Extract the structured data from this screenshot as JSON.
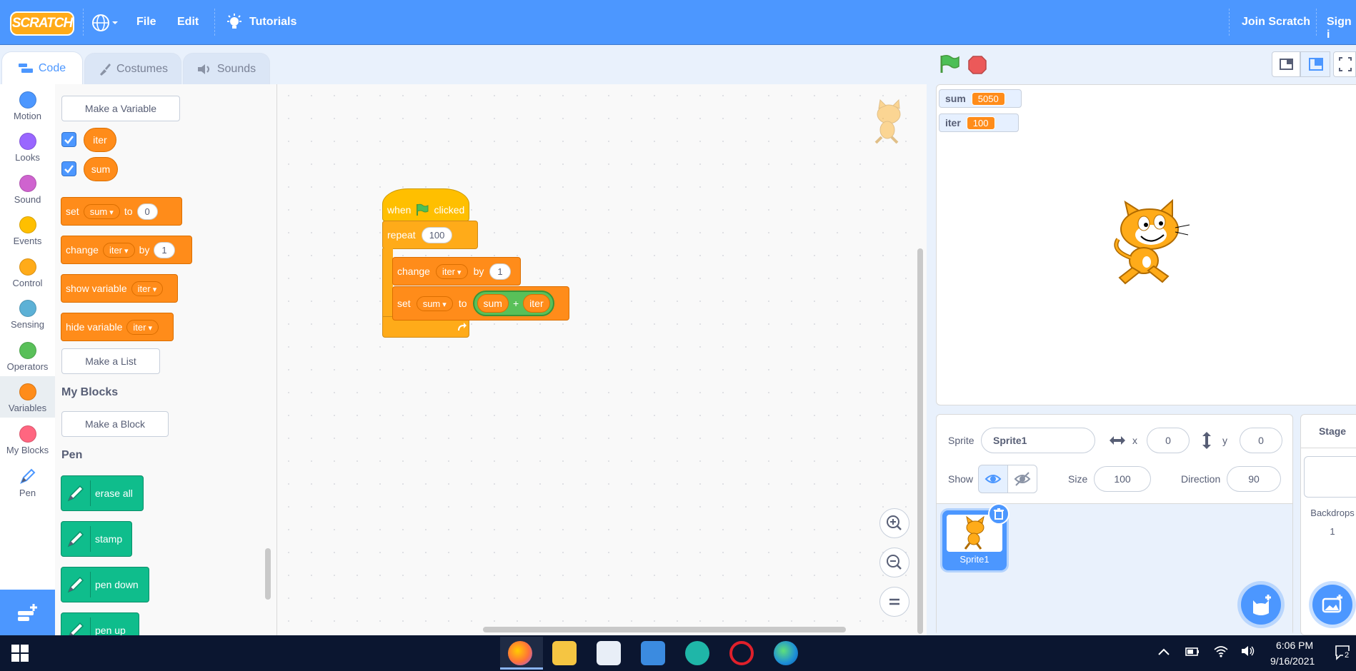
{
  "menu": {
    "logo_text": "SCRATCH",
    "file": "File",
    "edit": "Edit",
    "tutorials": "Tutorials",
    "join": "Join Scratch",
    "signin": "Sign i"
  },
  "tabs": {
    "code": "Code",
    "costumes": "Costumes",
    "sounds": "Sounds"
  },
  "categories": {
    "motion": "Motion",
    "looks": "Looks",
    "sound": "Sound",
    "events": "Events",
    "control": "Control",
    "sensing": "Sensing",
    "operators": "Operators",
    "variables": "Variables",
    "myblocks": "My Blocks",
    "pen": "Pen"
  },
  "palette": {
    "make_variable": "Make a Variable",
    "var_iter": "iter",
    "var_sum": "sum",
    "set_label": "set",
    "set_var": "sum",
    "set_to": "to",
    "set_value": "0",
    "change_label": "change",
    "change_var": "iter",
    "change_by": "by",
    "change_value": "1",
    "show_label": "show variable",
    "show_var": "iter",
    "hide_label": "hide variable",
    "hide_var": "iter",
    "make_list": "Make a List",
    "myblocks_heading": "My Blocks",
    "make_block": "Make a Block",
    "pen_heading": "Pen",
    "erase_all": "erase all",
    "stamp": "stamp",
    "pen_down": "pen down",
    "pen_up": "pen up"
  },
  "script": {
    "when": "when",
    "clicked": "clicked",
    "repeat": "repeat",
    "repeat_count": "100",
    "change": "change",
    "change_var": "iter",
    "change_by": "by",
    "change_value": "1",
    "set": "set",
    "set_var": "sum",
    "set_to": "to",
    "op_left": "sum",
    "op_symbol": "+",
    "op_right": "iter"
  },
  "stage": {
    "monitors": [
      {
        "name": "sum",
        "value": "5050"
      },
      {
        "name": "iter",
        "value": "100"
      }
    ]
  },
  "sprite_info": {
    "sprite_label": "Sprite",
    "sprite_name": "Sprite1",
    "x_label": "x",
    "x_value": "0",
    "y_label": "y",
    "y_value": "0",
    "show_label": "Show",
    "size_label": "Size",
    "size_value": "100",
    "direction_label": "Direction",
    "direction_value": "90",
    "thumb_name": "Sprite1"
  },
  "stage_panel": {
    "title": "Stage",
    "backdrops_label": "Backdrops",
    "backdrops_count": "1"
  },
  "taskbar": {
    "time": "6:06 PM",
    "date": "9/16/2021",
    "notif_count": "2"
  },
  "colors": {
    "menu_blue": "#4c97ff",
    "variables_orange": "#ff8c1a",
    "pen_green": "#0fbd8c"
  }
}
